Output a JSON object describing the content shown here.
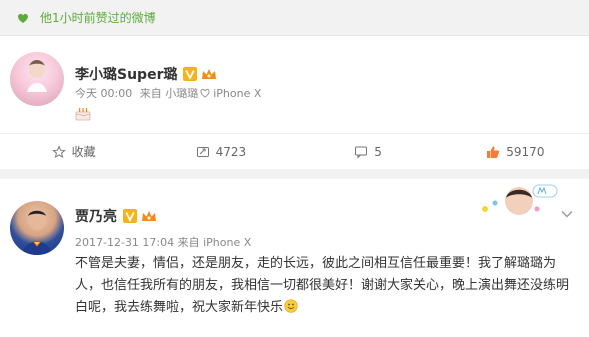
{
  "banner": {
    "text": "他1小时前赞过的微博",
    "accent": "#5cab3a"
  },
  "post1": {
    "username": "李小璐Super璐",
    "meta_time": "今天 00:00",
    "meta_from": "来自 小璐璐",
    "meta_device": "iPhone X",
    "actions": {
      "favorite_label": "收藏",
      "repost_count": "4723",
      "comment_count": "5",
      "like_count": "59170"
    }
  },
  "post2": {
    "username": "贾乃亮",
    "meta": "2017-12-31 17:04 来自 iPhone X",
    "body": "不管是夫妻，情侣，还是朋友，走的长远，彼此之间相互信任最重要！我了解璐璐为人，也信任我所有的朋友，我相信一切都很美好！谢谢大家关心，晚上演出舞还没练明白呢，我去练舞啦，祝大家新年快乐"
  },
  "colors": {
    "vip_orange": "#f28b1c",
    "verify_badge": "#f5b219",
    "like_orange": "#f57c3a"
  },
  "icons": {
    "banner": "heart-icon",
    "verified": "v-badge-icon",
    "membership": "crown-icon",
    "favorite": "star-icon",
    "repost": "repost-icon",
    "comment": "comment-icon",
    "like": "thumb-up-icon",
    "cake": "cake-icon",
    "chevron": "chevron-down-icon",
    "emoji": "smile-icon"
  }
}
